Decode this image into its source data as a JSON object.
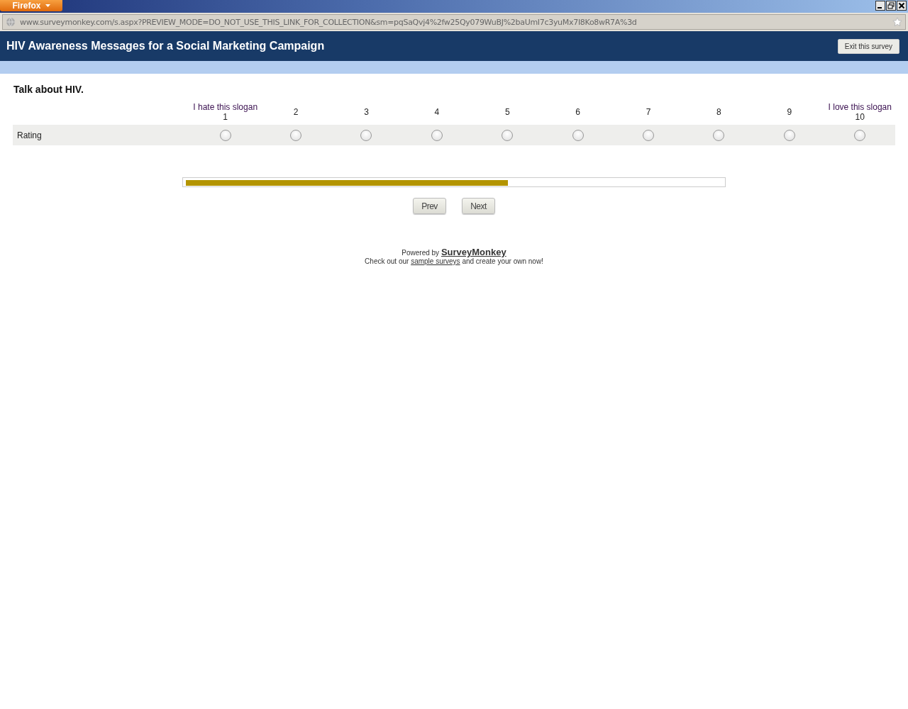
{
  "browser": {
    "menu_button": "Firefox",
    "url": "www.surveymonkey.com/s.aspx?PREVIEW_MODE=DO_NOT_USE_THIS_LINK_FOR_COLLECTION&sm=pqSaQvj4%2fw25Qy079WuBJ%2baUmI7c3yuMx7I8Ko8wR7A%3d"
  },
  "header": {
    "title": "HIV Awareness Messages for a Social Marketing Campaign",
    "exit_button": "Exit this survey"
  },
  "question": {
    "title": "Talk about HIV.",
    "row_label": "Rating",
    "scale": [
      {
        "caption": "I hate this slogan",
        "number": "1",
        "selected": false
      },
      {
        "number": "2",
        "selected": false
      },
      {
        "number": "3",
        "selected": false
      },
      {
        "number": "4",
        "selected": false
      },
      {
        "number": "5",
        "selected": false
      },
      {
        "number": "6",
        "selected": false
      },
      {
        "number": "7",
        "selected": false
      },
      {
        "number": "8",
        "selected": false
      },
      {
        "number": "9",
        "selected": false
      },
      {
        "caption": "I love this slogan",
        "number": "10",
        "selected": false
      }
    ]
  },
  "progress": {
    "level": 0.6
  },
  "buttons": [
    "Prev",
    "Next"
  ],
  "footer": {
    "powered_prefix": "Powered by",
    "powered_link": "SurveyMonkey",
    "promo_prefix": "Check out our",
    "promo_link": "sample surveys",
    "promo_suffix": "and create your own now!"
  }
}
